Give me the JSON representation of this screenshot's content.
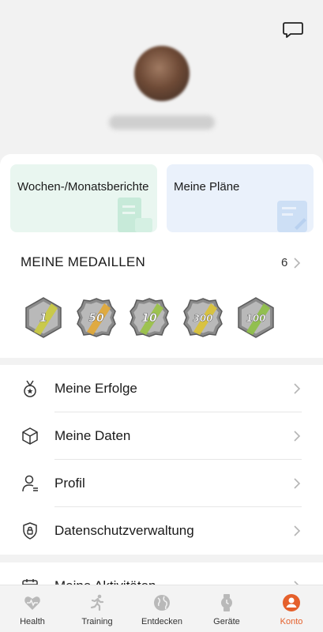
{
  "profile": {
    "avatar_alt": "avatar",
    "username": ""
  },
  "reports": {
    "weekly_monthly": "Wochen-/Monatsberichte",
    "my_plans": "Meine Pläne"
  },
  "medals": {
    "title": "MEINE MEDAILLEN",
    "count": "6",
    "items": [
      {
        "label": "1",
        "color": "#c9c944"
      },
      {
        "label": "50",
        "color": "#e0a93a"
      },
      {
        "label": "10",
        "color": "#9bc24a"
      },
      {
        "label": "300",
        "color": "#d9c23a"
      },
      {
        "label": "100",
        "color": "#8fbf4a"
      }
    ]
  },
  "menu": {
    "items": [
      {
        "label": "Meine Erfolge",
        "icon": "medal-icon"
      },
      {
        "label": "Meine Daten",
        "icon": "cube-icon"
      },
      {
        "label": "Profil",
        "icon": "user-icon"
      },
      {
        "label": "Datenschutzverwaltung",
        "icon": "lock-shield-icon"
      }
    ],
    "partial": {
      "label": "Meine Aktivitäten",
      "icon": "calendar-icon"
    }
  },
  "tabs": [
    {
      "label": "Health",
      "icon": "heart-icon"
    },
    {
      "label": "Training",
      "icon": "running-icon"
    },
    {
      "label": "Entdecken",
      "icon": "globe-icon"
    },
    {
      "label": "Geräte",
      "icon": "watch-icon"
    },
    {
      "label": "Konto",
      "icon": "account-icon",
      "active": true
    }
  ],
  "colors": {
    "accent": "#e5602b",
    "report_left_bg": "#e9f6f0",
    "report_right_bg": "#eaf1fb"
  }
}
